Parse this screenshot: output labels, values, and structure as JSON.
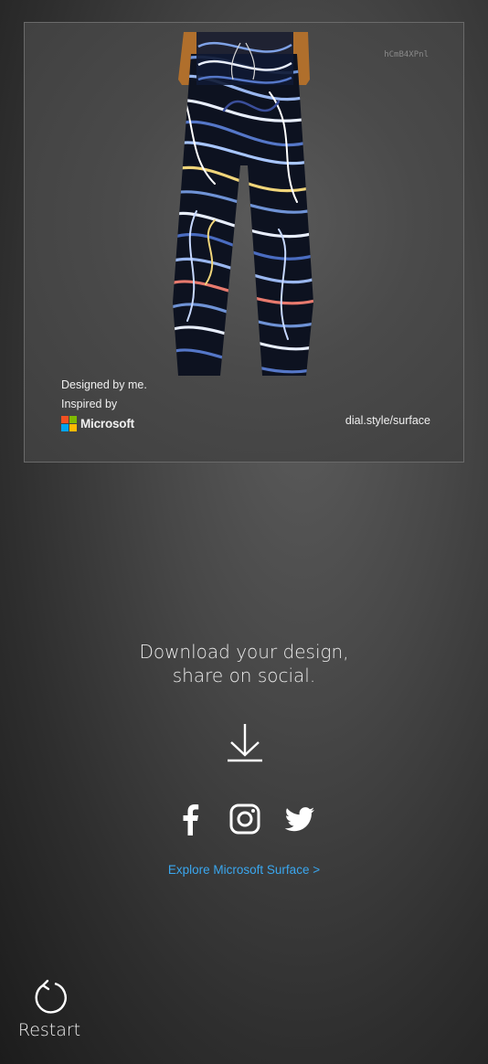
{
  "card": {
    "code": "hCmB4XPnl",
    "credit_line1": "Designed by me.",
    "credit_line2": "Inspired by",
    "brand_name": "Microsoft",
    "url": "dial.style/surface",
    "waistband_color": "#b06f2c",
    "brand_colors": [
      "#f25022",
      "#7fba00",
      "#00a4ef",
      "#ffb900"
    ]
  },
  "cta": {
    "line1": "Download your design,",
    "line2": "share on social."
  },
  "icons": {
    "download": "download-icon",
    "social": [
      "facebook-icon",
      "instagram-icon",
      "twitter-icon"
    ],
    "restart": "restart-icon"
  },
  "explore_link": "Explore Microsoft Surface >",
  "restart_label": "Restart",
  "colors": {
    "link": "#3aa7ef"
  }
}
